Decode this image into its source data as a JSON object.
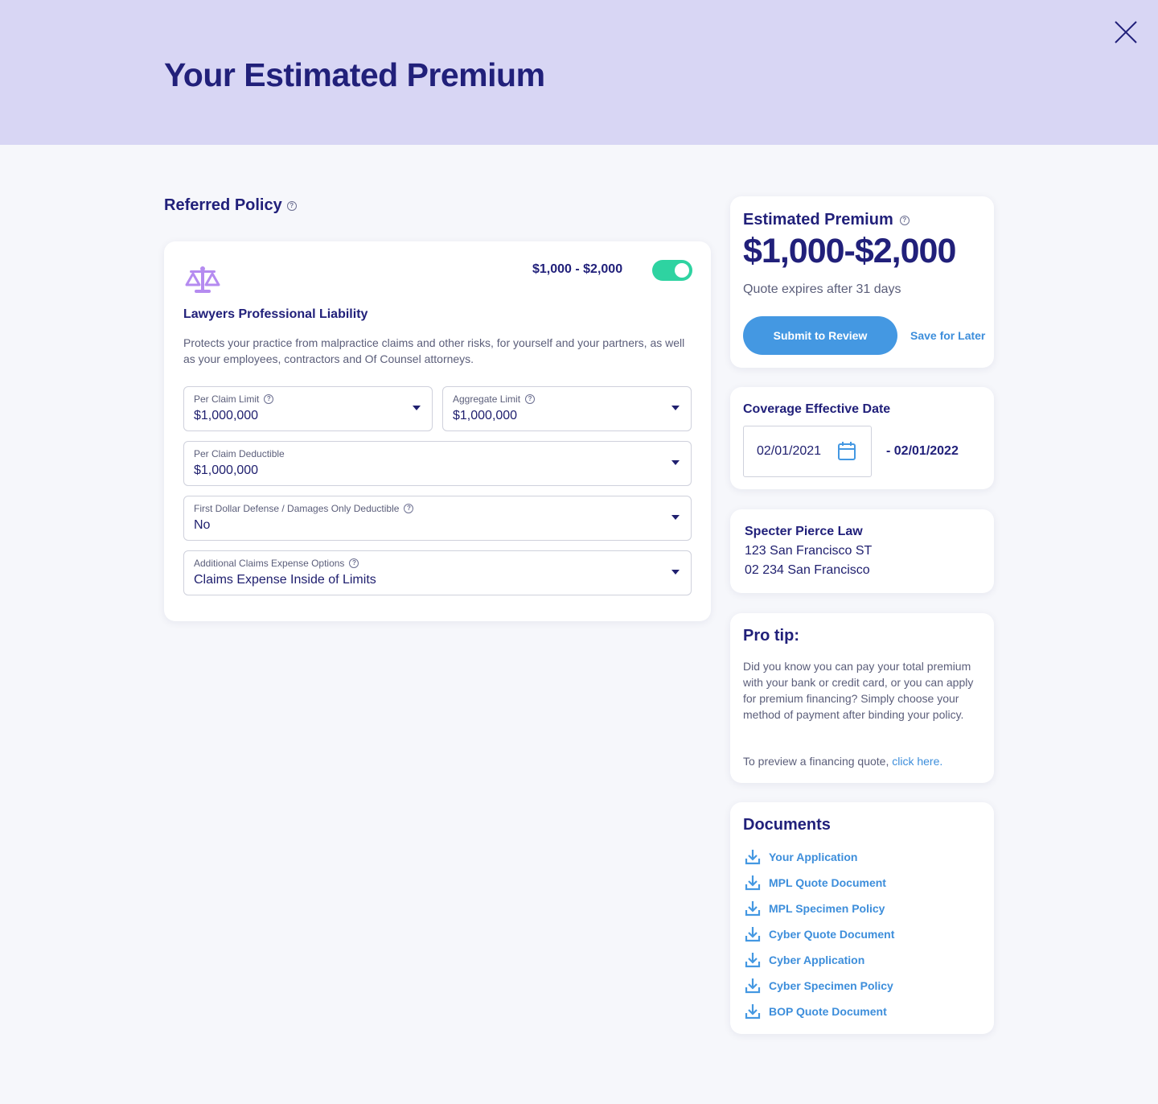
{
  "header": {
    "title": "Your Estimated Premium",
    "close_icon": "close-icon"
  },
  "referred": {
    "title": "Referred Policy",
    "help": "?",
    "policy": {
      "icon": "scale-icon",
      "price_range": "$1,000 - $2,000",
      "toggle_on": true,
      "name": "Lawyers Professional Liability",
      "description": "Protects your practice from malpractice claims and other risks, for yourself and your partners, as well as your employees, contractors and Of Counsel attorneys.",
      "fields": [
        {
          "label": "Per Claim Limit",
          "value": "$1,000,000",
          "help": true
        },
        {
          "label": "Aggregate Limit",
          "value": "$1,000,000",
          "help": true
        },
        {
          "label": "Per Claim Deductible",
          "value": "$1,000,000",
          "help": false
        },
        {
          "label": "First Dollar Defense / Damages Only Deductible",
          "value": "No",
          "help": true
        },
        {
          "label": "Additional Claims Expense Options",
          "value": "Claims Expense Inside of Limits",
          "help": true
        }
      ]
    }
  },
  "premium": {
    "title": "Estimated Premium",
    "value": "$1,000-$2,000",
    "expires": "Quote expires after 31 days",
    "submit_label": "Submit to Review",
    "save_label": "Save for Later"
  },
  "coverage": {
    "title": "Coverage Effective Date",
    "start": "02/01/2021",
    "end": "- 02/01/2022"
  },
  "address": {
    "name": "Specter Pierce Law",
    "line1": "123 San Francisco ST",
    "line2": "02 234 San Francisco"
  },
  "tip": {
    "title": "Pro tip:",
    "body": "Did you know you can pay your total premium with your bank or credit card, or you can apply for premium financing? Simply choose your method of payment after binding your policy.",
    "preview_prefix": "To preview a financing quote, ",
    "link": "click here."
  },
  "documents": {
    "title": "Documents",
    "items": [
      "Your Application",
      "MPL Quote Document",
      "MPL Specimen Policy",
      "Cyber Quote Document",
      "Cyber Application",
      "Cyber Specimen Policy",
      "BOP Quote Document"
    ]
  },
  "colors": {
    "header_bg": "#d8d6f4",
    "navy": "#21207a",
    "accent_blue": "#4498e2",
    "toggle_green": "#2ed3a1",
    "scale_purple": "#b58bf0"
  }
}
